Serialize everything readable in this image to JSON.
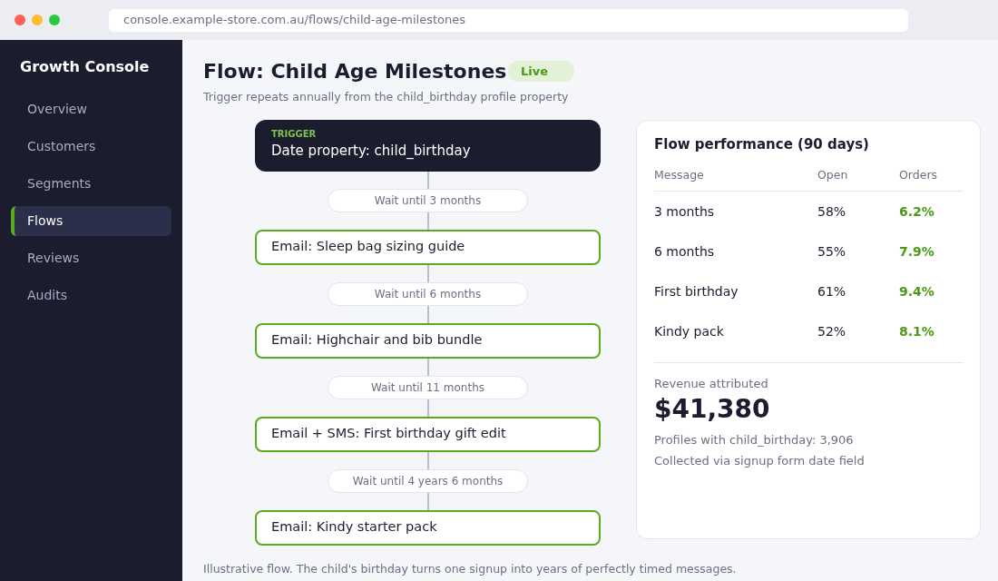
{
  "browser": {
    "url": "console.example-store.com.au/flows/child-age-milestones"
  },
  "sidebar": {
    "title": "Growth Console",
    "items": [
      {
        "label": "Overview",
        "selected": false
      },
      {
        "label": "Customers",
        "selected": false
      },
      {
        "label": "Segments",
        "selected": false
      },
      {
        "label": "Flows",
        "selected": true
      },
      {
        "label": "Reviews",
        "selected": false
      },
      {
        "label": "Audits",
        "selected": false
      }
    ]
  },
  "header": {
    "title": "Flow: Child Age Milestones",
    "status": "Live",
    "subtitle": "Trigger repeats annually from the child_birthday profile property"
  },
  "flow": [
    {
      "kind": "trigger",
      "caption": "TRIGGER",
      "label": "Date property: child_birthday"
    },
    {
      "kind": "wait",
      "label": "Wait until 3 months"
    },
    {
      "kind": "email",
      "label": "Email: Sleep bag sizing guide"
    },
    {
      "kind": "wait",
      "label": "Wait until 6 months"
    },
    {
      "kind": "email",
      "label": "Email: Highchair and bib bundle"
    },
    {
      "kind": "wait",
      "label": "Wait until 11 months"
    },
    {
      "kind": "email",
      "label": "Email + SMS: First birthday gift edit"
    },
    {
      "kind": "wait",
      "label": "Wait until 4 years 6 months"
    },
    {
      "kind": "email",
      "label": "Email: Kindy starter pack"
    }
  ],
  "performance": {
    "title": "Flow performance (90 days)",
    "columns": [
      "Message",
      "Open",
      "Orders"
    ],
    "rows": [
      [
        "3 months",
        "58%",
        "6.2%"
      ],
      [
        "6 months",
        "55%",
        "7.9%"
      ],
      [
        "First birthday",
        "61%",
        "9.4%"
      ],
      [
        "Kindy pack",
        "52%",
        "8.1%"
      ]
    ],
    "revenue_label": "Revenue attributed",
    "revenue": "$41,380",
    "notes": [
      "Profiles with child_birthday: 3,906",
      "Collected via signup form date field"
    ]
  },
  "footnote": "Illustrative flow. The child's birthday turns one signup into years of perfectly timed messages."
}
